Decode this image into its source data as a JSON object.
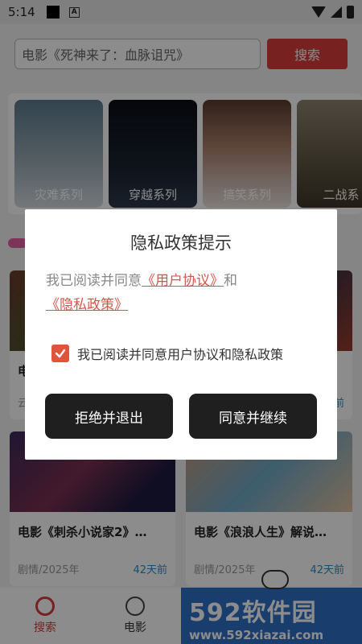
{
  "status_bar": {
    "time": "5:14",
    "notification_badge": "A"
  },
  "search": {
    "query": "电影《死神来了：血脉诅咒》",
    "button_label": "搜索"
  },
  "categories": [
    {
      "label": "灾难系列"
    },
    {
      "label": "穿越系列"
    },
    {
      "label": "搞笑系列"
    },
    {
      "label": "二战系"
    }
  ],
  "videos": [
    {
      "title": "电",
      "genre": "云",
      "time": ""
    },
    {
      "title": "",
      "genre": "",
      "time": "前"
    },
    {
      "title": "电影《刺杀小说家2》…",
      "genre": "剧情/2025年",
      "time": "42天前"
    },
    {
      "title": "电影《浪浪人生》解说…",
      "genre": "剧情/2025年",
      "time": "42天前"
    }
  ],
  "bottom_nav": {
    "items": [
      {
        "label": "搜索"
      },
      {
        "label": "电影"
      }
    ]
  },
  "watermark": {
    "big": "592软件园",
    "small": "www.592xiazai.com"
  },
  "dialog": {
    "title": "隐私政策提示",
    "text_prefix": "我已阅读并同意",
    "user_agreement_link": "《用户协议》",
    "text_and": "和",
    "privacy_link": "《隐私政策》",
    "checkbox_label": "我已阅读并同意用户协议和隐私政策",
    "checkbox_checked": true,
    "reject_button": "拒绝并退出",
    "agree_button": "同意并继续"
  },
  "colors": {
    "accent": "#d93c3c",
    "link": "#d9534a",
    "checkbox": "#e0533d",
    "button_dark": "#1f1f1f"
  }
}
